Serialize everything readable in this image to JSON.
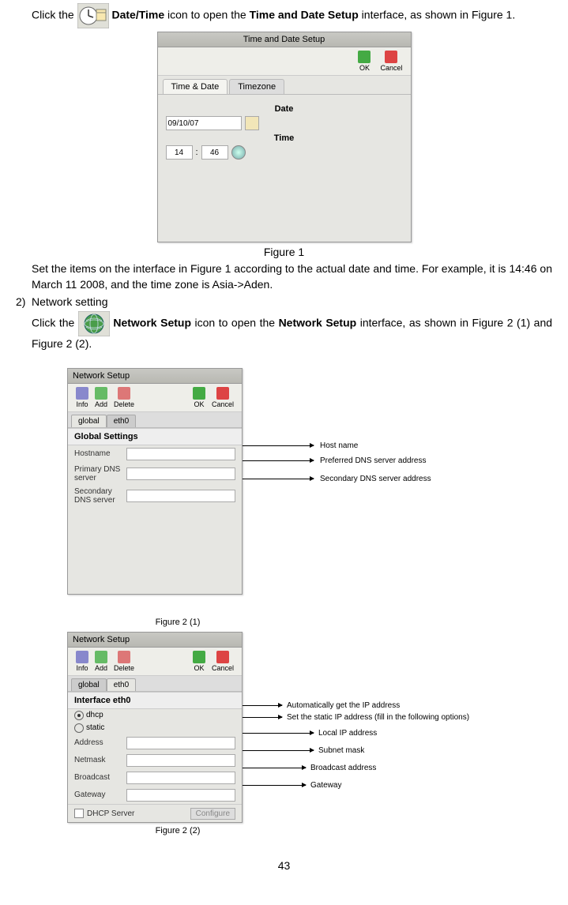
{
  "intro": {
    "p1_a": "Click the ",
    "p1_b": "Date/Time",
    "p1_c": " icon to open the ",
    "p1_d": "Time and Date Setup",
    "p1_e": " interface, as shown in Figure 1."
  },
  "fig1": {
    "title": "Time and Date Setup",
    "ok": "OK",
    "cancel": "Cancel",
    "tab1": "Time & Date",
    "tab2": "Timezone",
    "date_label": "Date",
    "date_value": "09/10/07",
    "time_label": "Time",
    "hour": "14",
    "min": "46",
    "caption": "Figure 1"
  },
  "after_fig1": {
    "p2": "Set the items on the interface in Figure 1 according to the actual date and time. For example, it is 14:46 on March 11 2008, and the time zone is Asia->Aden."
  },
  "item2": {
    "num": "2)",
    "label": "Network setting",
    "p3_a": "Click the ",
    "p3_b": "Network Setup",
    "p3_c": " icon to open the ",
    "p3_d": "Network Setup",
    "p3_e": " interface, as shown in Figure 2 (1) and Figure 2 (2)."
  },
  "fig2_1": {
    "title": "Network Setup",
    "info": "Info",
    "add": "Add",
    "delete": "Delete",
    "ok": "OK",
    "cancel": "Cancel",
    "tab_global": "global",
    "tab_eth0": "eth0",
    "section": "Global Settings",
    "hostname": "Hostname",
    "primary": "Primary DNS server",
    "secondary": "Secondary DNS server",
    "anno1": "Host name",
    "anno2": "Preferred DNS server address",
    "anno3": "Secondary DNS server address",
    "caption": "Figure 2 (1)"
  },
  "fig2_2": {
    "title": "Network Setup",
    "info": "Info",
    "add": "Add",
    "delete": "Delete",
    "ok": "OK",
    "cancel": "Cancel",
    "tab_global": "global",
    "tab_eth0": "eth0",
    "section": "Interface eth0",
    "dhcp": "dhcp",
    "static": "static",
    "address": "Address",
    "netmask": "Netmask",
    "broadcast": "Broadcast",
    "gateway": "Gateway",
    "dhcp_server": "DHCP Server",
    "configure": "Configure",
    "anno1": "Automatically get the IP address",
    "anno2": "Set the static IP address (fill in the following options)",
    "anno3": "Local IP address",
    "anno4": "Subnet mask",
    "anno5": "Broadcast address",
    "anno6": "Gateway",
    "caption": "Figure 2 (2)"
  },
  "page_number": "43"
}
